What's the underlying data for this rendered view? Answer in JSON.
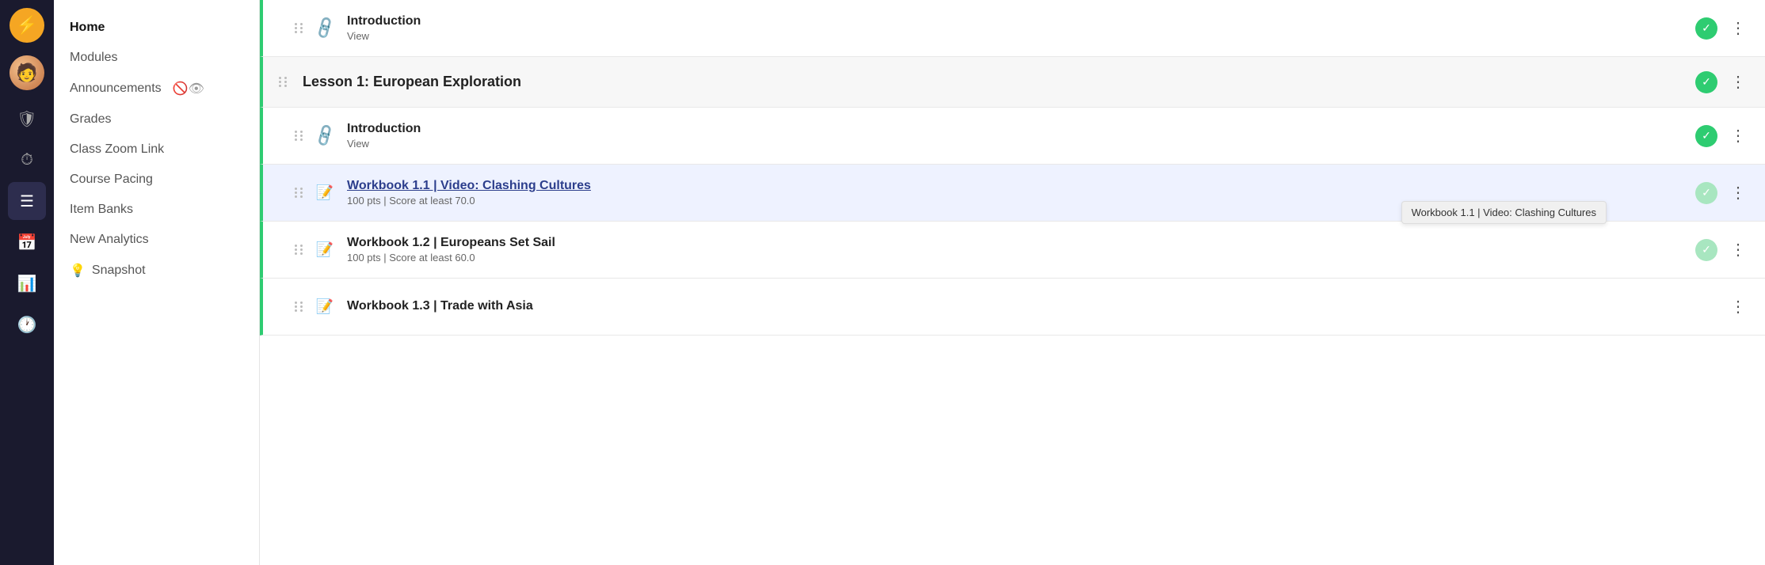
{
  "iconBar": {
    "logo": "⚡",
    "icons": [
      {
        "name": "lightning-icon",
        "symbol": "⚡",
        "active": false
      },
      {
        "name": "avatar-icon",
        "symbol": "👤",
        "active": false
      },
      {
        "name": "shield-icon",
        "symbol": "🛡",
        "active": false
      },
      {
        "name": "clock-icon",
        "symbol": "⏱",
        "active": false
      },
      {
        "name": "list-icon",
        "symbol": "☰",
        "active": true
      },
      {
        "name": "calendar-icon",
        "symbol": "📅",
        "active": false
      },
      {
        "name": "chart-icon",
        "symbol": "📊",
        "active": false
      },
      {
        "name": "time-icon",
        "symbol": "🕐",
        "active": false
      }
    ]
  },
  "sidebar": {
    "items": [
      {
        "label": "Home",
        "active": true,
        "icon": null
      },
      {
        "label": "Modules",
        "active": false,
        "icon": null
      },
      {
        "label": "Announcements",
        "active": false,
        "icon": "eye-slash"
      },
      {
        "label": "Grades",
        "active": false,
        "icon": null
      },
      {
        "label": "Class Zoom Link",
        "active": false,
        "icon": null
      },
      {
        "label": "Course Pacing",
        "active": false,
        "icon": null
      },
      {
        "label": "Item Banks",
        "active": false,
        "icon": null
      },
      {
        "label": "New Analytics",
        "active": false,
        "icon": null
      },
      {
        "label": "Snapshot",
        "active": false,
        "icon": "bulb"
      }
    ]
  },
  "content": {
    "rows": [
      {
        "type": "item",
        "title": "Introduction",
        "subtitle": "View",
        "icon": "link",
        "checked": true,
        "faded": false
      },
      {
        "type": "lesson",
        "title": "Lesson 1: European Exploration",
        "subtitle": null,
        "icon": null,
        "checked": true,
        "faded": false
      },
      {
        "type": "item",
        "title": "Introduction",
        "subtitle": "View",
        "icon": "link",
        "checked": true,
        "faded": false
      },
      {
        "type": "item",
        "title": "Workbook 1.1 | Video: Clashing Cultures",
        "subtitle": "100 pts  |  Score at least 70.0",
        "icon": "edit",
        "checked": true,
        "faded": true,
        "highlighted": true,
        "linked": true,
        "tooltip": "Workbook 1.1 | Video: Clashing Cultures",
        "hasArrow": true
      },
      {
        "type": "item",
        "title": "Workbook 1.2 | Europeans Set Sail",
        "subtitle": "100 pts  |  Score at least 60.0",
        "icon": "edit",
        "checked": true,
        "faded": true
      },
      {
        "type": "item",
        "title": "Workbook 1.3 | Trade with Asia",
        "subtitle": "",
        "icon": "edit",
        "checked": false,
        "faded": false,
        "partial": true
      }
    ]
  }
}
